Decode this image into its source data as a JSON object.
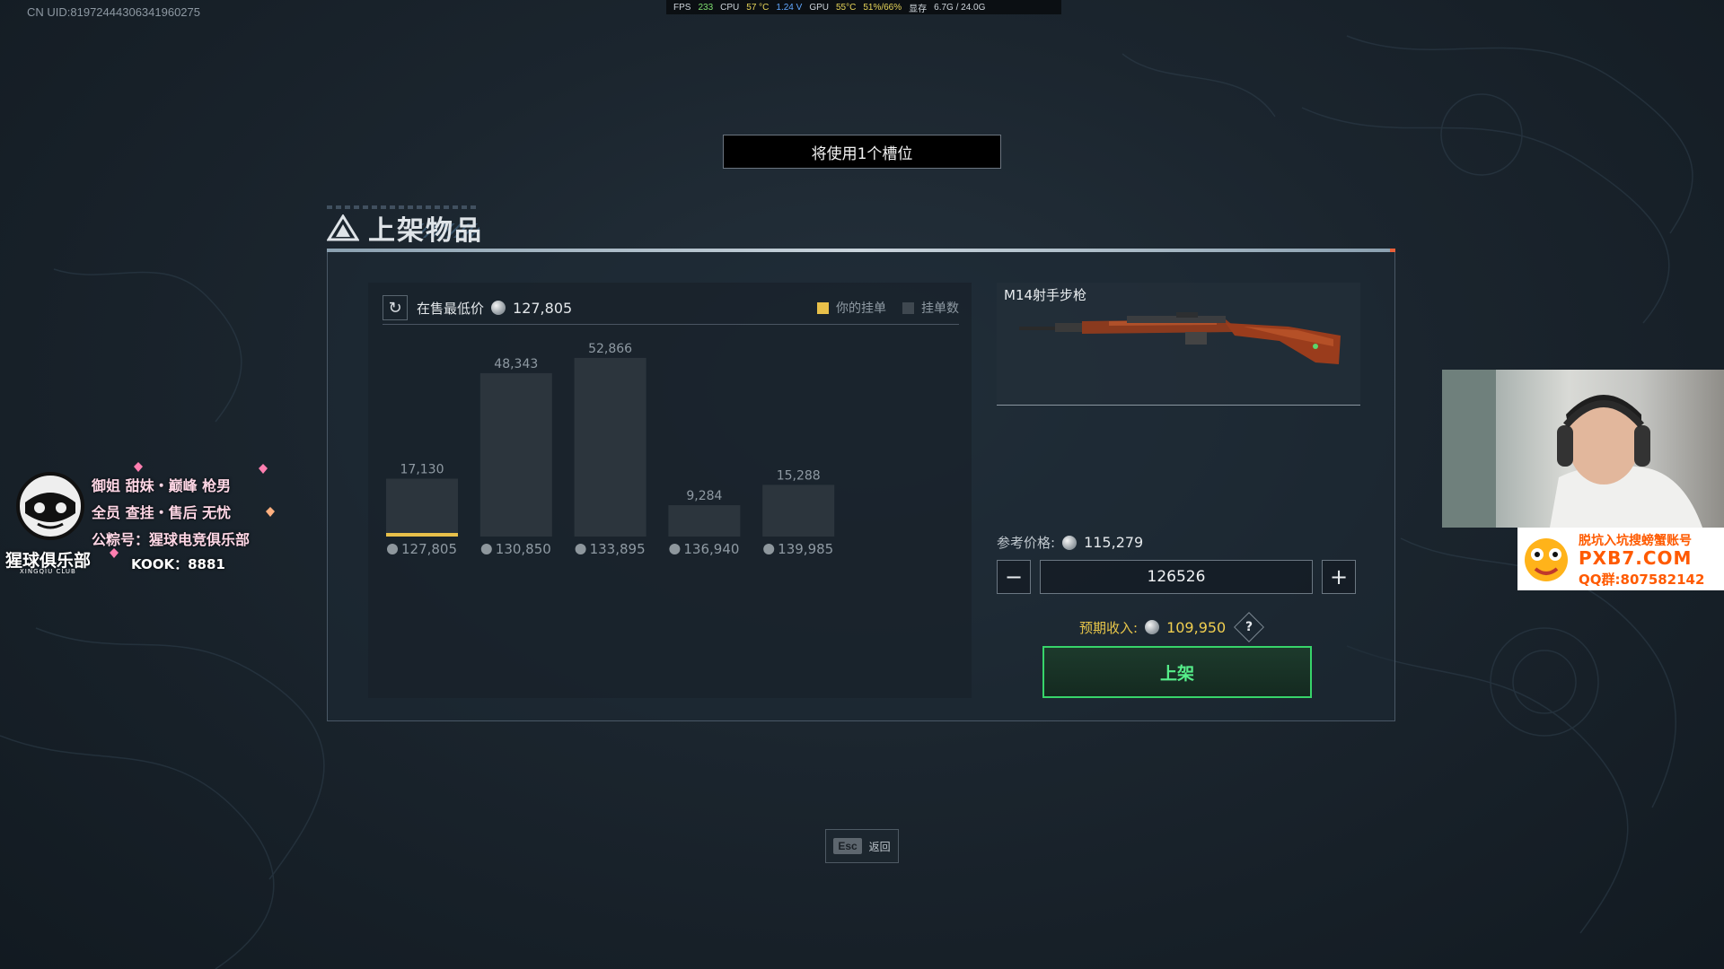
{
  "overlay": {
    "uid": "CN UID:81972444306341960275",
    "hud": {
      "fps_label": "FPS",
      "fps_value": "233",
      "cpu_label": "CPU",
      "cpu_temp": "57 °C",
      "cpu_volt": "1.24 V",
      "gpu_label": "GPU",
      "gpu_temp": "55°C",
      "gpu_load": "51%/66%",
      "mem_label": "显存",
      "mem_value": "6.7G / 24.0G"
    }
  },
  "banner": {
    "text": "将使用1个槽位"
  },
  "panel": {
    "title": "上架物品"
  },
  "market": {
    "refresh_icon": "refresh-icon",
    "lowest_label": "在售最低价",
    "lowest_price": "127,805",
    "legend": [
      {
        "label": "你的挂单",
        "color": "#e8c04a"
      },
      {
        "label": "挂单数",
        "color": "#3f4850"
      }
    ]
  },
  "chart_data": {
    "type": "bar",
    "categories": [
      "127,805",
      "130,850",
      "133,895",
      "136,940",
      "139,985"
    ],
    "values": [
      17130,
      48343,
      52866,
      9284,
      15288
    ],
    "value_labels": [
      "17,130",
      "48,343",
      "52,866",
      "9,284",
      "15,288"
    ],
    "highlight_index": 0,
    "colors": {
      "bar": "#2c353d",
      "highlight": "#e8c04a",
      "text": "#8f9aa3"
    },
    "ylim": [
      0,
      60000
    ],
    "legend": "top-right",
    "grid": false
  },
  "item": {
    "name": "M14射手步枪"
  },
  "pricing": {
    "reference_label": "参考价格:",
    "reference_price": "115,279",
    "price_value": "126526",
    "decrement_symbol": "−",
    "increment_symbol": "+",
    "income_label": "预期收入:",
    "income_value": "109,950",
    "help_symbol": "?",
    "list_button": "上架"
  },
  "footer": {
    "esc_key": "Esc",
    "esc_label": "返回"
  },
  "stream_overlay": {
    "club_lines": [
      "御姐 甜妹・巅峰 枪男",
      "全员 查挂・售后 无忧",
      "公粽号：猩球电竞俱乐部"
    ],
    "club_name": "猩球俱乐部",
    "club_sub": "XINGQIU CLUB",
    "kook": "KOOK：8881",
    "ad_line1": "脱坑入坑搜螃蟹账号",
    "ad_line2": "PXB7.COM",
    "ad_line3": "QQ群:807582142"
  }
}
